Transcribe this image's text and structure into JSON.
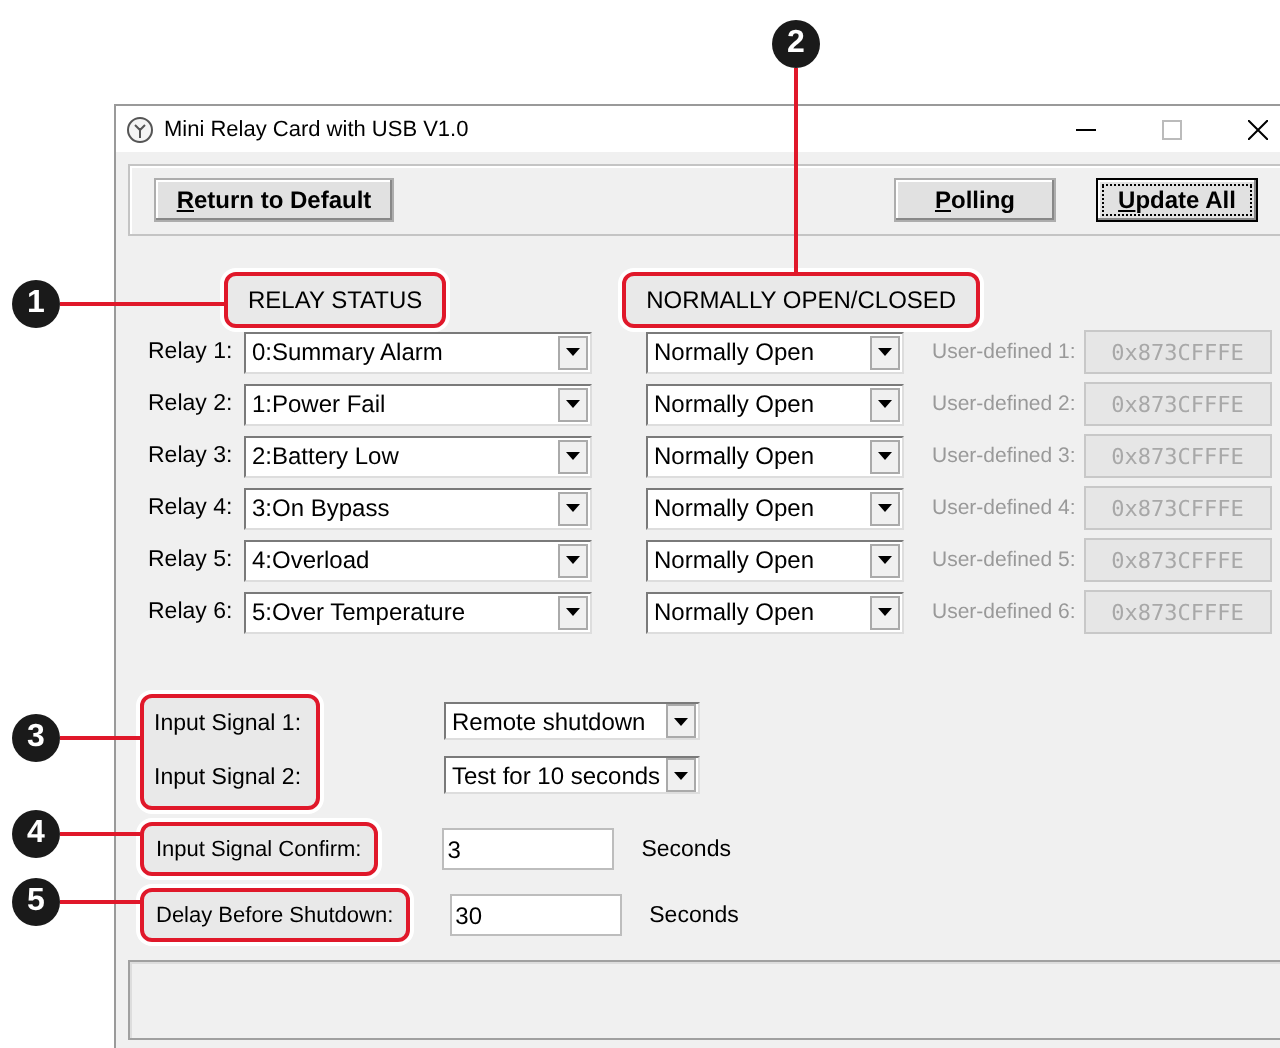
{
  "window": {
    "title": "Mini Relay Card with USB V1.0"
  },
  "toolbar": {
    "buttons": [
      {
        "label": "Return to Default",
        "focused": false
      },
      {
        "label": "Polling",
        "focused": false
      },
      {
        "label": "Update All",
        "focused": true
      }
    ]
  },
  "headers": [
    {
      "label": "RELAY STATUS",
      "callout": "1"
    },
    {
      "label": "NORMALLY OPEN/CLOSED",
      "callout": "2"
    }
  ],
  "relays": [
    {
      "label": "Relay 1:",
      "status": "0:Summary Alarm",
      "contact": "Normally Open",
      "user_label": "User-defined 1:",
      "user_value": "0x873CFFFE",
      "user_enabled": false
    },
    {
      "label": "Relay 2:",
      "status": "1:Power Fail",
      "contact": "Normally Open",
      "user_label": "User-defined 2:",
      "user_value": "0x873CFFFE",
      "user_enabled": false
    },
    {
      "label": "Relay 3:",
      "status": "2:Battery Low",
      "contact": "Normally Open",
      "user_label": "User-defined 3:",
      "user_value": "0x873CFFFE",
      "user_enabled": false
    },
    {
      "label": "Relay 4:",
      "status": "3:On Bypass",
      "contact": "Normally Open",
      "user_label": "User-defined 4:",
      "user_value": "0x873CFFFE",
      "user_enabled": false
    },
    {
      "label": "Relay 5:",
      "status": "4:Overload",
      "contact": "Normally Open",
      "user_label": "User-defined 5:",
      "user_value": "0x873CFFFE",
      "user_enabled": false
    },
    {
      "label": "Relay 6:",
      "status": "5:Over Temperature",
      "contact": "Normally Open",
      "user_label": "User-defined 6:",
      "user_value": "0x873CFFFE",
      "user_enabled": false
    }
  ],
  "input_signals": {
    "callout": "3",
    "items": [
      {
        "label": "Input Signal 1:",
        "value": "Remote shutdown"
      },
      {
        "label": "Input Signal 2:",
        "value": "Test for 10 seconds"
      }
    ]
  },
  "timing": [
    {
      "label": "Input Signal Confirm:",
      "value": "3",
      "unit": "Seconds",
      "callout": "4"
    },
    {
      "label": "Delay Before Shutdown:",
      "value": "30",
      "unit": "Seconds",
      "callout": "5"
    }
  ]
}
